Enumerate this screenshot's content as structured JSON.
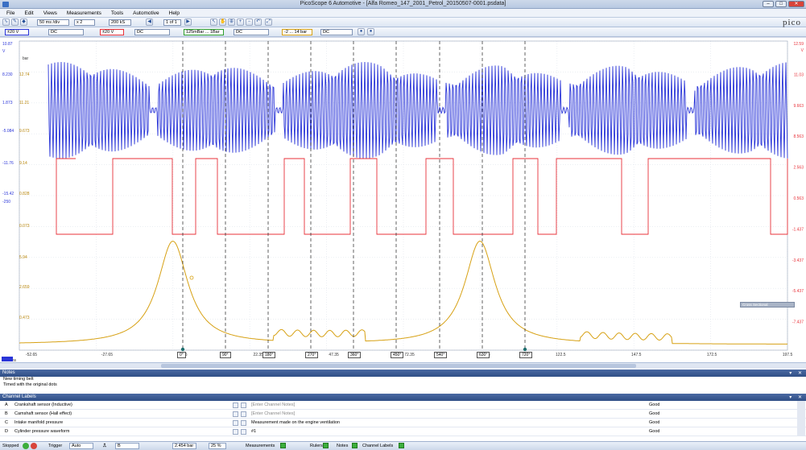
{
  "window": {
    "title": "PicoScope 6 Automotive - [Alfa Romeo_147_2001_Petrol_20150507-0001.psdata]"
  },
  "menu": [
    "File",
    "Edit",
    "Views",
    "Measurements",
    "Tools",
    "Automotive",
    "Help"
  ],
  "toolbar1": {
    "timebase": "50 ms /div",
    "zoom": "x 2",
    "samples": "200 kS",
    "buffer": "1 of 1"
  },
  "toolbar2": {
    "chA_range": "±20 V",
    "chA_coupling": "DC",
    "chB_range": "±20 V",
    "chB_coupling": "DC",
    "chC_probe": "125mBar ... 1Bar",
    "chC_coupling": "DC",
    "chD_range": "-2 ... 14 bar",
    "chD_coupling": "DC"
  },
  "plot": {
    "left_top_label": "10.87",
    "left_unit": "V",
    "left_scale_blue": [
      "8.230",
      "1.873",
      "-5.084"
    ],
    "left_scale_blue2": [
      "12.74",
      "11.21",
      "9.673"
    ],
    "left_scale_red": [
      "-11.76",
      "-15.42",
      "-250"
    ],
    "left_scale_red2": [
      "9.14",
      "0.828",
      "0.073"
    ],
    "left_scale_gold": [
      "5.94",
      "2.659",
      "0.473"
    ],
    "left_unit_bar": "bar",
    "right_scale": [
      "12.59",
      "11.03",
      "9.663",
      "8.563",
      "2.563",
      "0.563",
      "-1.437",
      "-3.437",
      "-5.437",
      "-7.437"
    ],
    "right_unit": "V",
    "x_ticks": [
      "-52.65",
      "-27.65",
      "-2.65",
      "22.35",
      "47.35",
      "72.35",
      "97.35",
      "122.5",
      "147.5",
      "172.5",
      "197.5"
    ],
    "x_unit": "ms",
    "degree_rulers": [
      "0°",
      "90°",
      "180°",
      "270°",
      "360°",
      "450°",
      "540°",
      "630°",
      "720°"
    ],
    "floating_label": "Cross Sectional"
  },
  "chart_data": {
    "type": "line",
    "title": "",
    "xlabel": "ms",
    "ylabel": "",
    "x_range": [
      -52.65,
      197.5
    ],
    "series": [
      {
        "name": "Crankshaft sensor (inductive)",
        "color": "#2a35d8",
        "style": "oscillating bursts with gaps at -9, 32, 85, 125, 166 ms"
      },
      {
        "name": "Camshaft sensor (Hall effect)",
        "color": "#e8323a",
        "style": "square wave"
      },
      {
        "name": "Cylinder pressure waveform",
        "color": "#d7a114",
        "peaks_ms": [
          -2.65,
          97.35
        ]
      }
    ]
  },
  "notes": {
    "title": "Notes",
    "lines": [
      "New timing belt",
      "Timed with the original dots"
    ]
  },
  "channel_labels": {
    "title": "Channel Labels",
    "rows": [
      {
        "ch": "A",
        "name": "Crankshaft sensor (Inductive)",
        "note": "[Enter Channel Notes]",
        "status": "Good"
      },
      {
        "ch": "B",
        "name": "Camshaft sensor (Hall effect)",
        "note": "[Enter Channel Notes]",
        "status": "Good"
      },
      {
        "ch": "C",
        "name": "Intake manifold pressure",
        "note": "Measurement made on the engine ventilation",
        "status": "Good"
      },
      {
        "ch": "D",
        "name": "Cylinder pressure waveform",
        "note": "#1",
        "status": "Good"
      }
    ]
  },
  "status": {
    "state": "Stopped",
    "trigger_label": "Trigger",
    "trigger_mode": "Auto",
    "trigger_channel": "B",
    "trigger_level": "2.454 bar",
    "pretrigger": "25 %",
    "measurements": "Measurements",
    "rulers": "Rulers",
    "notes": "Notes",
    "channel_labels": "Channel Labels"
  }
}
